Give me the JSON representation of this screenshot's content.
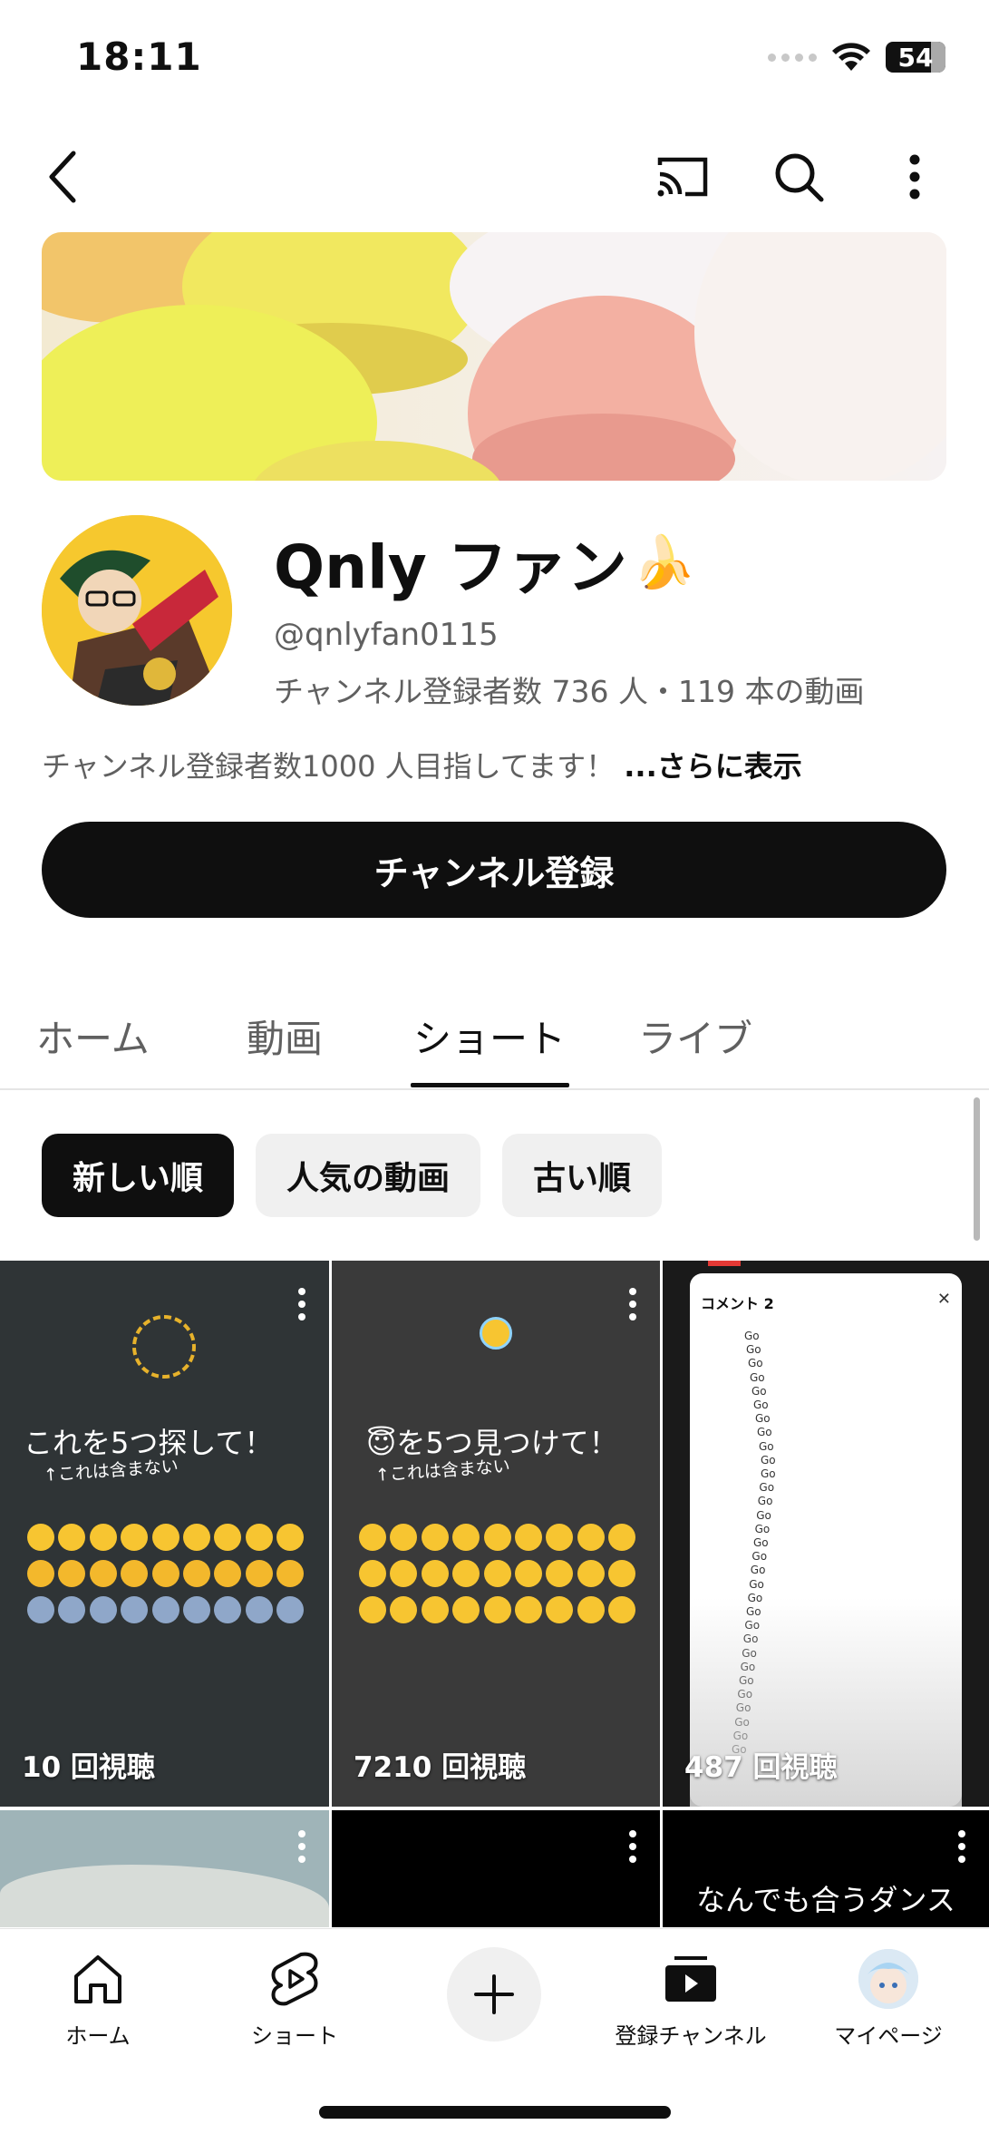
{
  "status_bar": {
    "time": "18:11",
    "battery": "54"
  },
  "channel": {
    "name": "Qnly ファン",
    "name_emoji": "🍌",
    "handle": "@qnlyfan0115",
    "meta": "チャンネル登録者数 736 人・119 本の動画",
    "description": "チャンネル登録者数1000 人目指してます！",
    "show_more": "...さらに表示",
    "subscribe_label": "チャンネル登録"
  },
  "tabs": [
    "ホーム",
    "動画",
    "ショート",
    "ライブ"
  ],
  "active_tab": "ショート",
  "sort_chips": [
    "新しい順",
    "人気の動画",
    "古い順"
  ],
  "active_chip": "新しい順",
  "shorts": [
    {
      "title": "これを5つ探して！",
      "subtitle": "↑これは含まない",
      "views": "10 回視聴"
    },
    {
      "title": "😇を5つ見つけて！",
      "subtitle": "↑これは含まない",
      "views": "7210 回視聴"
    },
    {
      "title": "コメント 2",
      "views": "487 回視聴",
      "comment_word": "Go"
    },
    {
      "title": "",
      "views": ""
    },
    {
      "title": "",
      "views": ""
    },
    {
      "title": "なんでも合うダンス",
      "views": ""
    }
  ],
  "bottom_nav": [
    "ホーム",
    "ショート",
    "登録チャンネル",
    "マイページ"
  ],
  "colors": {
    "accent": "#0f0f0f",
    "secondary_text": "#606060",
    "chip_bg": "#f0f0f0"
  },
  "icons": [
    "back-icon",
    "cast-icon",
    "search-icon",
    "more-vert-icon",
    "home-icon",
    "shorts-icon",
    "plus-icon",
    "subscriptions-icon"
  ]
}
